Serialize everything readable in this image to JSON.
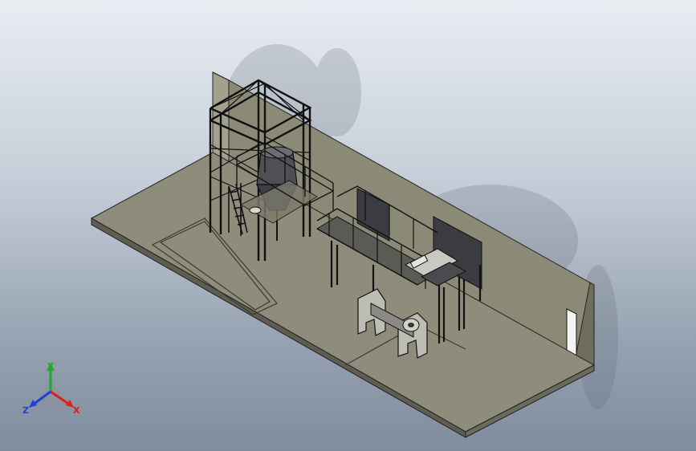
{
  "view": {
    "colors": {
      "background_top": "#e9edf2",
      "background_bottom": "#7f8c9d",
      "floor": "#8e8c7a",
      "wall": "#8b8a76",
      "steel": "#111111",
      "axis_x": "#e21b1b",
      "axis_y": "#1faa2e",
      "axis_z": "#1f3fd9"
    }
  },
  "triad": {
    "x_label": "X",
    "y_label": "Y",
    "z_label": "Z"
  }
}
